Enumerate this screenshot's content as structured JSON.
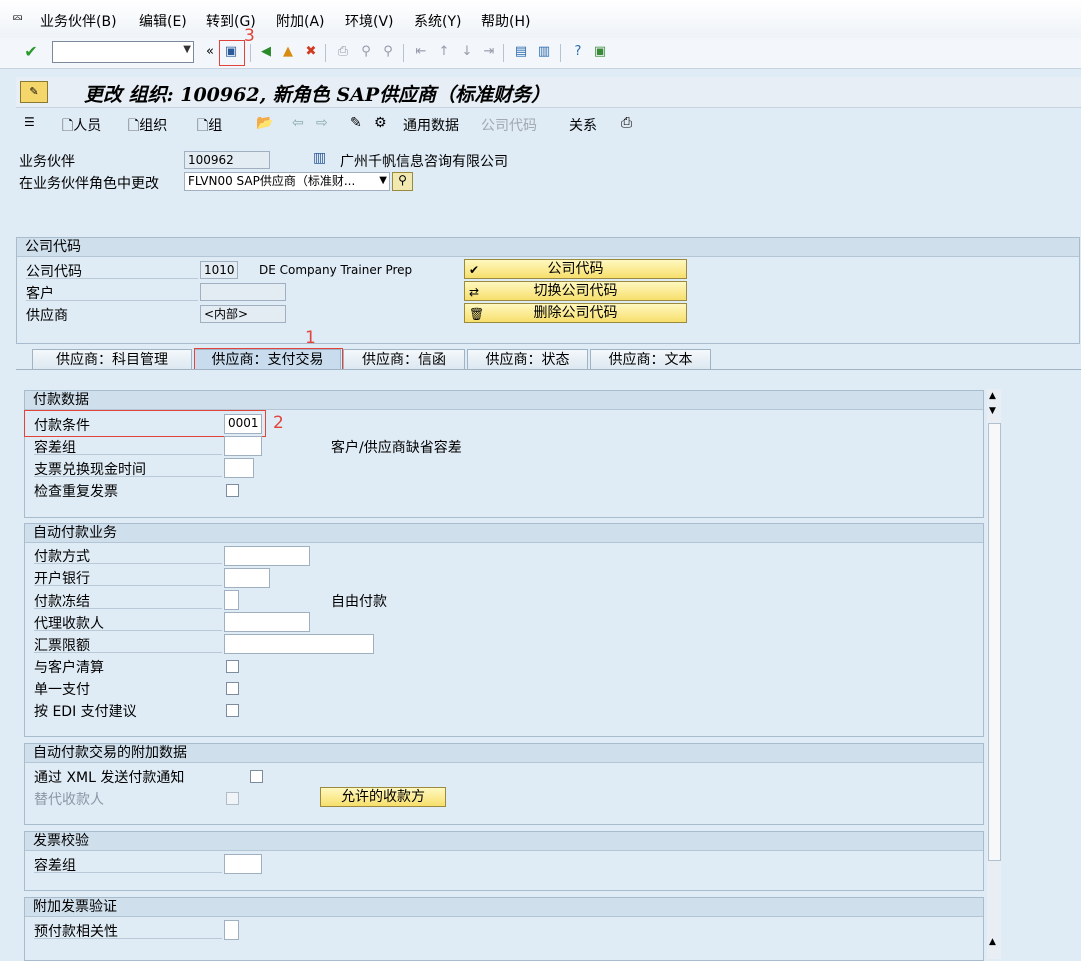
{
  "menu": [
    "业务伙伴(B)",
    "编辑(E)",
    "转到(G)",
    "附加(A)",
    "环境(V)",
    "系统(Y)",
    "帮助(H)"
  ],
  "title": "更改 组织: 100962, 新角色 SAP供应商（标准财务）",
  "toolbar2": {
    "person": "人员",
    "org": "组织",
    "group": "组",
    "general_data": "通用数据",
    "company_code": "公司代码",
    "relations": "关系"
  },
  "header": {
    "bp_label": "业务伙伴",
    "bp_value": "100962",
    "bp_name": "广州千帆信息咨询有限公司",
    "role_label": "在业务伙伴角色中更改",
    "role_value": "FLVN00 SAP供应商（标准财..."
  },
  "company": {
    "section": "公司代码",
    "cc_label": "公司代码",
    "cc_value": "1010",
    "cc_name": "DE Company Trainer Prep",
    "customer_label": "客户",
    "customer_value": "",
    "vendor_label": "供应商",
    "vendor_value": "<内部>",
    "btn_cc": "公司代码",
    "btn_switch": "切换公司代码",
    "btn_delete": "删除公司代码"
  },
  "tabs": [
    "供应商：科目管理",
    "供应商：支付交易",
    "供应商：信函",
    "供应商：状态",
    "供应商：文本"
  ],
  "payment_data": {
    "title": "付款数据",
    "terms_label": "付款条件",
    "terms_value": "0001",
    "tol_label": "容差组",
    "tol_desc": "客户/供应商缺省容差",
    "cheque_label": "支票兑换现金时间",
    "dup_label": "检查重复发票"
  },
  "auto_payment": {
    "title": "自动付款业务",
    "method_label": "付款方式",
    "bank_label": "开户银行",
    "block_label": "付款冻结",
    "block_desc": "自由付款",
    "payee_label": "代理收款人",
    "bill_label": "汇票限额",
    "clear_label": "与客户清算",
    "single_label": "单一支付",
    "edi_label": "按 EDI 支付建议"
  },
  "auto_extra": {
    "title": "自动付款交易的附加数据",
    "xml_label": "通过 XML 发送付款通知",
    "alt_label": "替代收款人",
    "btn_payees": "允许的收款方"
  },
  "invoice_check": {
    "title": "发票校验",
    "tol_label": "容差组"
  },
  "extra_invoice": {
    "title": "附加发票验证",
    "prepay_label": "预付款相关性"
  },
  "annotations": [
    "1",
    "2",
    "3"
  ]
}
